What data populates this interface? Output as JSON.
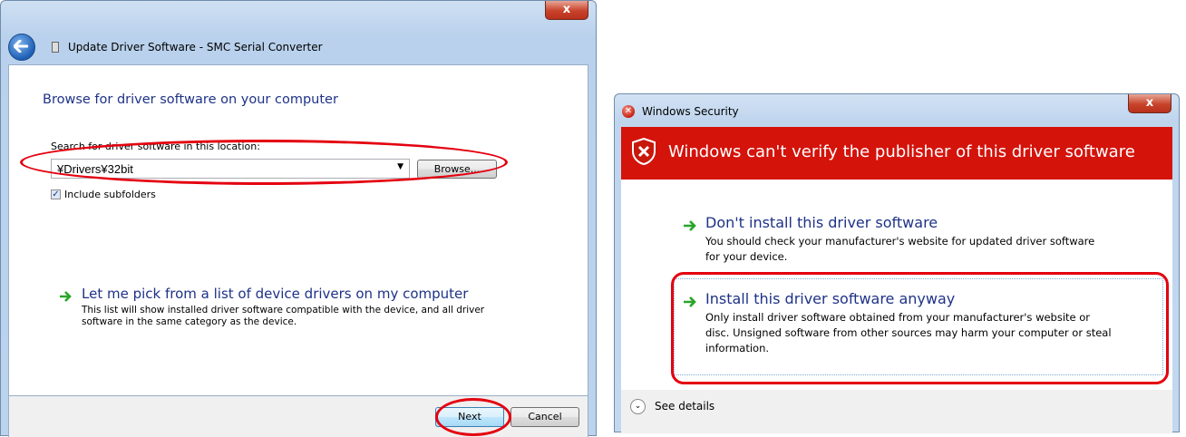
{
  "left_window": {
    "close_label": "x",
    "title": "Update Driver Software - SMC Serial Converter",
    "heading": "Browse for driver software on your computer",
    "search_label": "Search for driver software in this location:",
    "path_value": "¥Drivers¥32bit",
    "browse_label": "Browse...",
    "include_subfolders_label": "Include subfolders",
    "include_subfolders_checked": true,
    "pick_title": "Let me pick from a list of device drivers on my computer",
    "pick_desc_line1": "This list will show installed driver software compatible with the device, and all driver",
    "pick_desc_line2": "software in the same category as the device.",
    "next_label": "Next",
    "cancel_label": "Cancel"
  },
  "right_window": {
    "close_label": "x",
    "title": "Windows Security",
    "banner_text": "Windows can't verify the publisher of this driver software",
    "option1_title": "Don't install this driver software",
    "option1_desc_line1": "You should check your manufacturer's website for updated driver software",
    "option1_desc_line2": "for your device.",
    "option2_title": "Install this driver software anyway",
    "option2_desc_line1": "Only install driver software obtained from your manufacturer's website or",
    "option2_desc_line2": "disc. Unsigned software from other sources may harm your computer or steal",
    "option2_desc_line3": "information.",
    "details_label": "See details"
  },
  "colors": {
    "highlight": "#e4000f",
    "heading_blue": "#1e3287",
    "banner_red": "#d4130b",
    "arrow_green": "#2aa52a"
  }
}
